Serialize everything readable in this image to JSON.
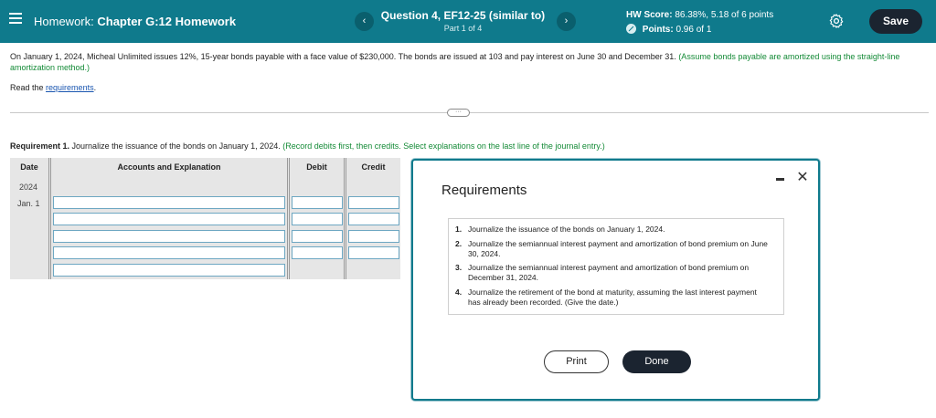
{
  "header": {
    "homework_label": "Homework:",
    "homework_name": "Chapter G:12 Homework",
    "question_title": "Question 4, EF12-25 (similar to)",
    "part": "Part 1 of 4",
    "prev_label": "‹",
    "next_label": "›",
    "hw_score_label": "HW Score:",
    "hw_score_value": "86.38%, 5.18 of 6 points",
    "points_label": "Points:",
    "points_value": "0.96 of 1",
    "save_label": "Save",
    "accent_color": "#0f7a8c"
  },
  "question": {
    "text": "On January 1, 2024, Micheal Unlimited issues 12%, 15-year bonds payable with a face value of $230,000. The bonds are issued at 103 and pay interest on June 30 and December 31.",
    "hint": "(Assume bonds payable are amortized using the straight-line amortization method.)",
    "read_prefix": "Read the",
    "read_link": "requirements",
    "read_suffix": "."
  },
  "requirement1": {
    "label": "Requirement 1.",
    "text": "Journalize the issuance of the bonds on January 1, 2024.",
    "hint": "(Record debits first, then credits. Select explanations on the last line of the journal entry.)"
  },
  "journal": {
    "headers": {
      "date": "Date",
      "accounts": "Accounts and Explanation",
      "debit": "Debit",
      "credit": "Credit"
    },
    "year": "2024",
    "date": "Jan. 1"
  },
  "modal": {
    "title": "Requirements",
    "items": [
      {
        "num": "1.",
        "text": "Journalize the issuance of the bonds on January 1, 2024."
      },
      {
        "num": "2.",
        "text": "Journalize the semiannual interest payment and amortization of bond premium on June 30, 2024."
      },
      {
        "num": "3.",
        "text": "Journalize the semiannual interest payment and amortization of bond premium on December 31, 2024."
      },
      {
        "num": "4.",
        "text": "Journalize the retirement of the bond at maturity, assuming the last interest payment has already been recorded. (Give the date.)"
      }
    ],
    "print_label": "Print",
    "done_label": "Done"
  }
}
